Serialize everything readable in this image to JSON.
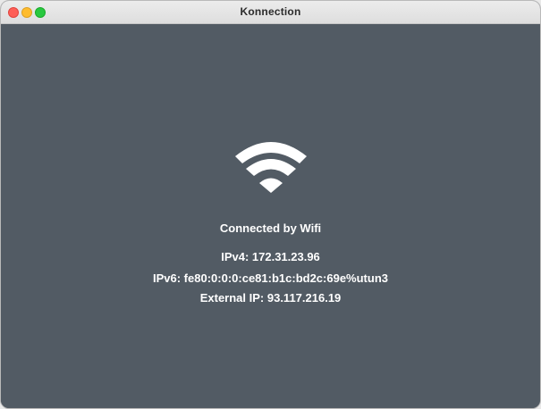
{
  "window": {
    "title": "Konnection"
  },
  "connection": {
    "status": "Connected by Wifi",
    "icon": "wifi-icon",
    "ipv4": "IPv4: 172.31.23.96",
    "ipv6": "IPv6: fe80:0:0:0:ce81:b1c:bd2c:69e%utun3",
    "external_ip": "External IP: 93.117.216.19"
  },
  "colors": {
    "background": "#525b64",
    "text": "#ffffff",
    "close": "#fe5f57",
    "minimize": "#febc2e",
    "zoom": "#28c840"
  }
}
